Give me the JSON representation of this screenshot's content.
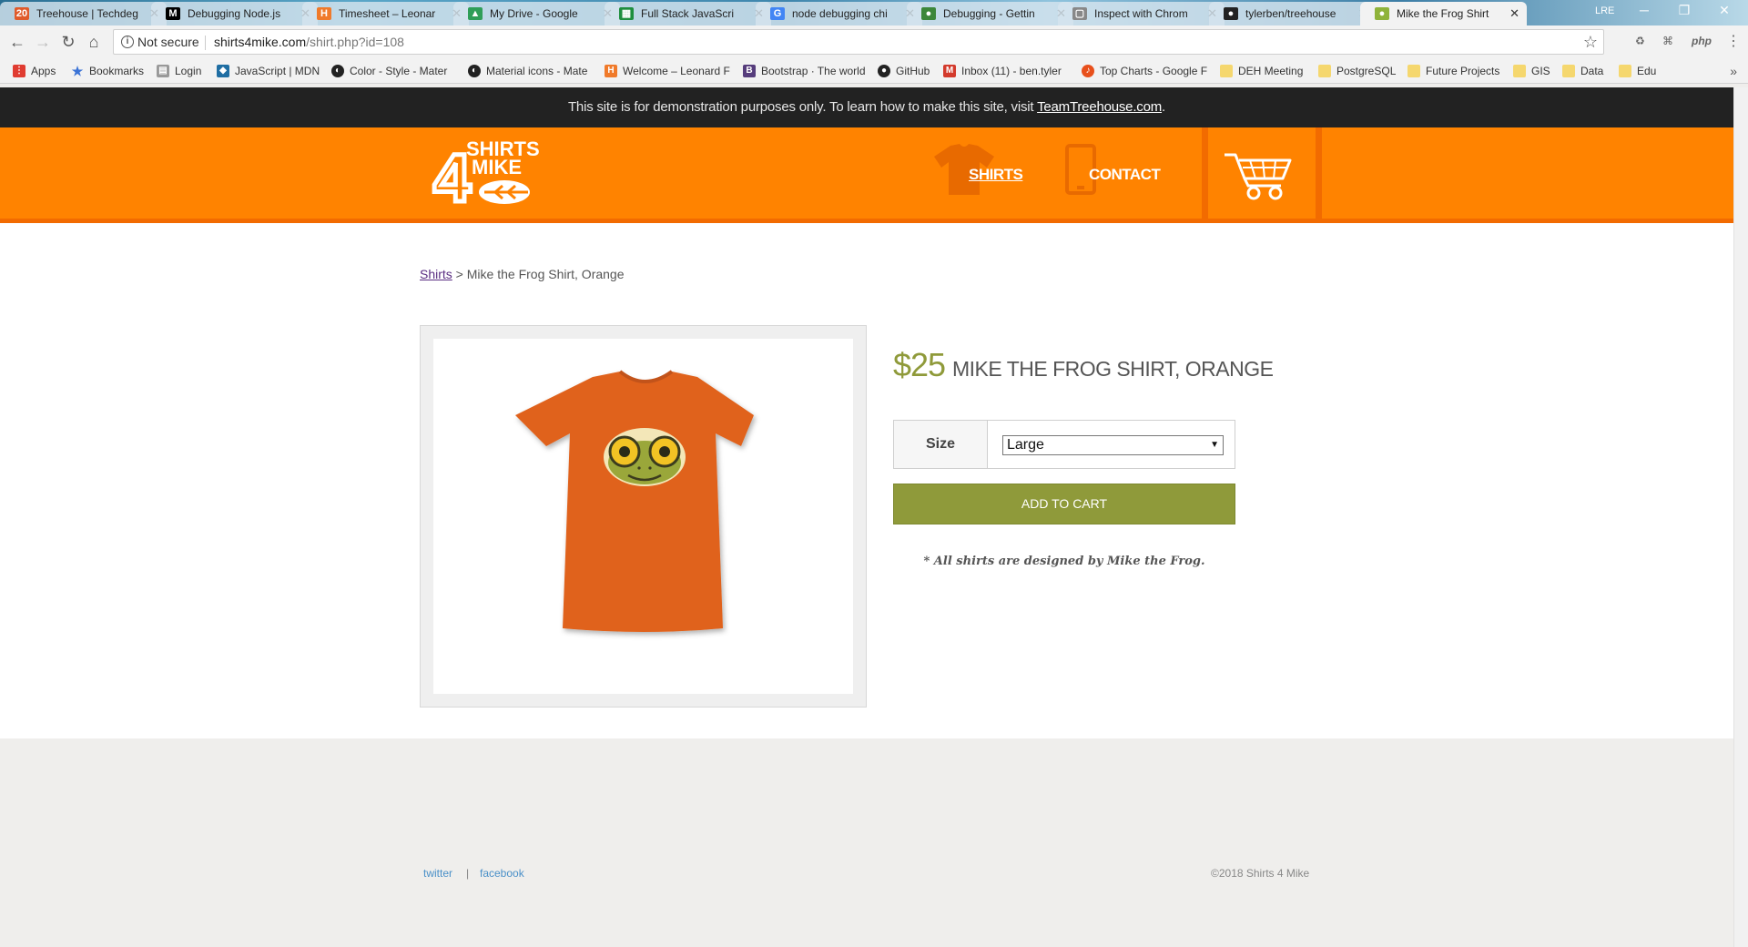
{
  "browser": {
    "tabs": [
      {
        "label": "Treehouse | Techdeg",
        "color": "#e05a2a",
        "badge": "20"
      },
      {
        "label": "Debugging Node.js",
        "color": "#000000",
        "badge": "M"
      },
      {
        "label": "Timesheet – Leonar",
        "color": "#f07a2a",
        "badge": "H"
      },
      {
        "label": "My Drive - Google",
        "color": "#2f9e58",
        "badge": "▲"
      },
      {
        "label": "Full Stack JavaScri",
        "color": "#1e8e3e",
        "badge": "▦"
      },
      {
        "label": "node debugging chi",
        "color": "#4285f4",
        "badge": "G"
      },
      {
        "label": "Debugging - Gettin",
        "color": "#3c873a",
        "badge": "●"
      },
      {
        "label": "Inspect with Chrom",
        "color": "#888888",
        "badge": "▢"
      },
      {
        "label": "tylerben/treehouse",
        "color": "#222222",
        "badge": "●"
      },
      {
        "label": "Mike the Frog Shirt",
        "color": "#8fb33a",
        "badge": "●"
      }
    ],
    "window_label": "LRE",
    "nav": {
      "back": "←",
      "forward": "→",
      "reload": "↻",
      "home": "⌂"
    },
    "omnibox": {
      "security": "Not secure",
      "host": "shirts4mike.com",
      "path": "/shirt.php?id=108"
    },
    "extensions": [
      "♻",
      "⌘",
      "php",
      "⋮"
    ],
    "bookmarks": [
      {
        "label": "Apps",
        "color": "#e03c31"
      },
      {
        "label": "Bookmarks",
        "color": "#3b73d6"
      },
      {
        "label": "Login",
        "color": "#999999"
      },
      {
        "label": "JavaScript | MDN",
        "color": "#1f6ea3"
      },
      {
        "label": "Color - Style - Mater",
        "color": "#222222"
      },
      {
        "label": "Material icons - Mate",
        "color": "#222222"
      },
      {
        "label": "Welcome – Leonard F",
        "color": "#f07a2a"
      },
      {
        "label": "Bootstrap · The world",
        "color": "#563d7c"
      },
      {
        "label": "GitHub",
        "color": "#222222"
      },
      {
        "label": "Inbox (11) - ben.tyler",
        "color": "#d33a2c"
      },
      {
        "label": "Top Charts - Google F",
        "color": "#e8501c"
      },
      {
        "label": "DEH Meeting",
        "color": "#f5d76e"
      },
      {
        "label": "PostgreSQL",
        "color": "#f5d76e"
      },
      {
        "label": "Future Projects",
        "color": "#f5d76e"
      },
      {
        "label": "GIS",
        "color": "#f5d76e"
      },
      {
        "label": "Data",
        "color": "#f5d76e"
      },
      {
        "label": "Edu",
        "color": "#f5d76e"
      }
    ],
    "bookmarks_more": "»"
  },
  "site": {
    "demo_notice": "This site is for demonstration purposes only. To learn how to make this site, visit",
    "demo_link": "TeamTreehouse.com",
    "demo_period": ".",
    "logo": {
      "line1": "SHIRTS",
      "num": "4",
      "line2": "MIKE"
    },
    "nav": [
      {
        "label": "SHIRTS",
        "active": true
      },
      {
        "label": "CONTACT",
        "active": false
      }
    ],
    "breadcrumb": {
      "link": "Shirts",
      "sep": " > ",
      "current": "Mike the Frog Shirt, Orange"
    },
    "product": {
      "price": "$25",
      "title": "MIKE THE FROG SHIRT, ORANGE",
      "size_label": "Size",
      "size_value": "Large",
      "add_button": "ADD TO CART",
      "note": "* All shirts are designed by Mike the Frog."
    },
    "footer": {
      "twitter": "twitter",
      "sep": "|",
      "facebook": "facebook",
      "copyright": "©2018 Shirts 4 Mike"
    },
    "colors": {
      "brand_orange": "#ff8300",
      "accent_olive": "#8f9a3a",
      "dark_bar": "#222222"
    }
  }
}
